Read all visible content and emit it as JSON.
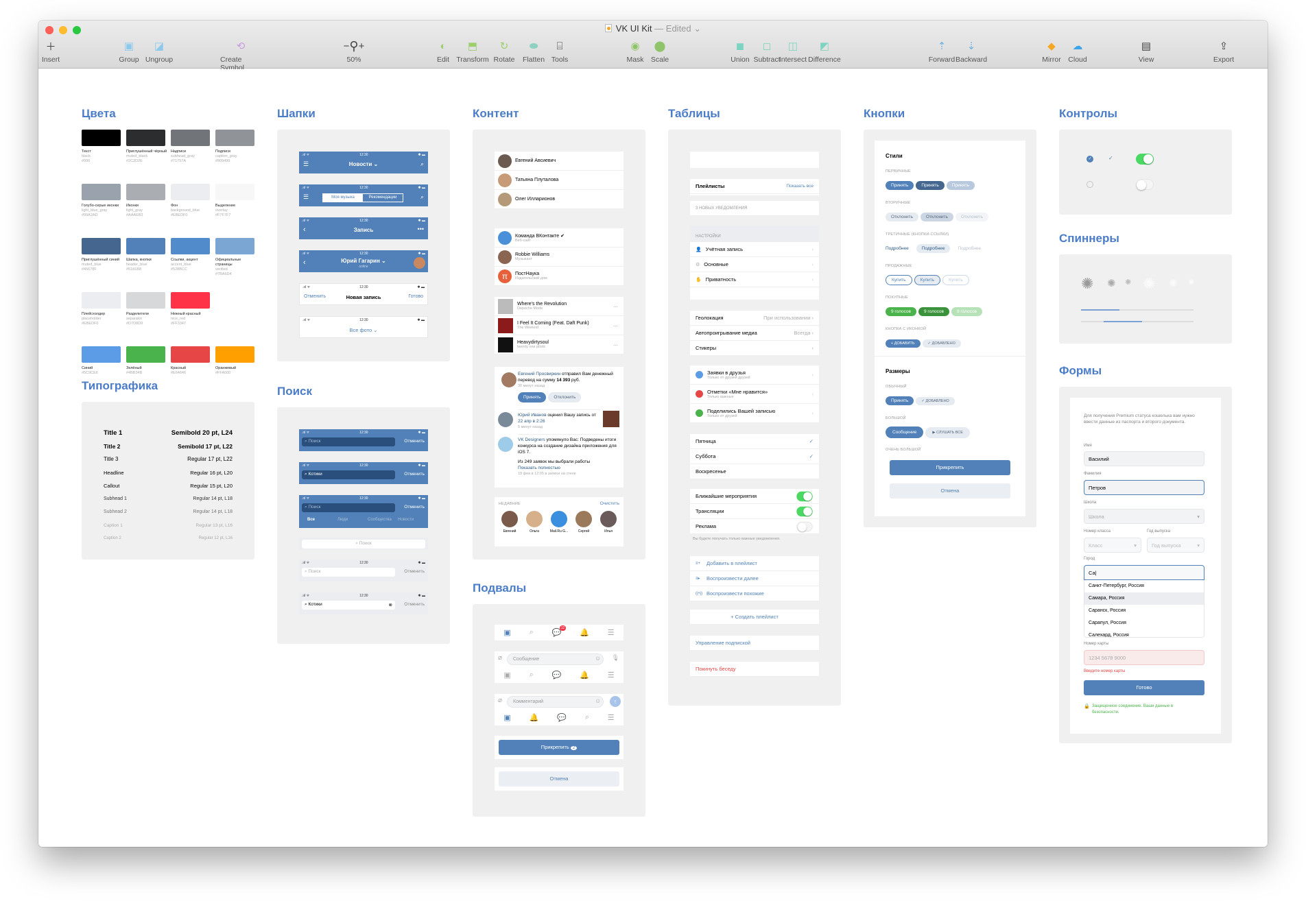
{
  "window": {
    "title": "VK UI Kit",
    "title_status": "— Edited",
    "toolbar": [
      {
        "label": "Insert",
        "icon": "plus-icon"
      },
      {
        "label": "Group",
        "icon": "group-icon"
      },
      {
        "label": "Ungroup",
        "icon": "ungroup-icon"
      },
      {
        "label": "Create Symbol",
        "icon": "symbol-icon"
      },
      {
        "label": "50%",
        "icon": "zoom-icon"
      },
      {
        "label": "Edit",
        "icon": "edit-icon"
      },
      {
        "label": "Transform",
        "icon": "transform-icon"
      },
      {
        "label": "Rotate",
        "icon": "rotate-icon"
      },
      {
        "label": "Flatten",
        "icon": "flatten-icon"
      },
      {
        "label": "Tools",
        "icon": "tools-icon"
      },
      {
        "label": "Mask",
        "icon": "mask-icon"
      },
      {
        "label": "Scale",
        "icon": "scale-icon"
      },
      {
        "label": "Union",
        "icon": "union-icon"
      },
      {
        "label": "Subtract",
        "icon": "subtract-icon"
      },
      {
        "label": "Intersect",
        "icon": "intersect-icon"
      },
      {
        "label": "Difference",
        "icon": "difference-icon"
      },
      {
        "label": "Forward",
        "icon": "forward-icon"
      },
      {
        "label": "Backward",
        "icon": "backward-icon"
      },
      {
        "label": "Mirror",
        "icon": "mirror-icon"
      },
      {
        "label": "Cloud",
        "icon": "cloud-icon"
      },
      {
        "label": "View",
        "icon": "view-icon"
      },
      {
        "label": "Export",
        "icon": "export-icon"
      }
    ],
    "zoom_minus": "−",
    "zoom_plus": "+"
  },
  "sections": {
    "colors": "Цвета",
    "typography": "Типографика",
    "headers": "Шапки",
    "search": "Поиск",
    "content": "Контент",
    "footers": "Подвалы",
    "tables": "Таблицы",
    "buttons": "Кнопки",
    "controls": "Контролы",
    "spinners": "Спиннеры",
    "forms": "Формы"
  },
  "colors": [
    {
      "name": "Текст",
      "key": "black",
      "hex": "#000"
    },
    {
      "name": "Приглушённый чёрный",
      "key": "muted_black",
      "hex": "#2C2D2E"
    },
    {
      "name": "Надписи",
      "key": "subhead_gray",
      "hex": "#71757A"
    },
    {
      "name": "Подписи",
      "key": "caption_gray",
      "hex": "#909499"
    },
    {
      "name": "Голубо-серые иконки",
      "key": "light_blue_gray",
      "hex": "#99A2AD"
    },
    {
      "name": "Иконки",
      "key": "light_gray",
      "hex": "#AAAEB3"
    },
    {
      "name": "Фон",
      "key": "background_blue",
      "hex": "#EBEDF0"
    },
    {
      "name": "Выделение",
      "key": "overlay",
      "hex": "#F7F7F7"
    },
    {
      "name": "Приглушённый синий",
      "key": "muted_blue",
      "hex": "#45678F"
    },
    {
      "name": "Шапка, кнопки",
      "key": "header_blue",
      "hex": "#5181B8"
    },
    {
      "name": "Ссылки, акцент",
      "key": "accent_blue",
      "hex": "#528BCC"
    },
    {
      "name": "Официальные страницы",
      "key": "verified",
      "hex": "#7BA6D4"
    },
    {
      "name": "Плейсхолдер",
      "key": "placeholder",
      "hex": "#EBEDF0"
    },
    {
      "name": "Разделители",
      "key": "separator",
      "hex": "#D7D8D9"
    },
    {
      "name": "Нежный красный",
      "key": "nice_red",
      "hex": "#FF3347"
    },
    {
      "name": "",
      "key": "",
      "hex": ""
    },
    {
      "name": "Синий",
      "key": "",
      "hex": "#5C9CE6"
    },
    {
      "name": "Зелёный",
      "key": "",
      "hex": "#4BB34B"
    },
    {
      "name": "Красный",
      "key": "",
      "hex": "#E64646"
    },
    {
      "name": "Оранжевый",
      "key": "",
      "hex": "#FFA000"
    }
  ],
  "typography": [
    {
      "name": "Title 1",
      "spec": "Semibold 20 pt, L24"
    },
    {
      "name": "Title 2",
      "spec": "Semibold 17 pt, L22"
    },
    {
      "name": "Title 3",
      "spec": "Regular 17 pt, L22"
    },
    {
      "name": "Headline",
      "spec": "Regular 16 pt, L20"
    },
    {
      "name": "Callout",
      "spec": "Regular 15 pt, L20"
    },
    {
      "name": "Subhead 1",
      "spec": "Regular 14 pt, L18"
    },
    {
      "name": "Subhead 2",
      "spec": "Regular 14 pt, L18"
    },
    {
      "name": "Caption 1",
      "spec": "Regular 13 pt, L16"
    },
    {
      "name": "Caption 2",
      "spec": "Regular 12 pt, L16"
    }
  ],
  "status": {
    "time": "12:30"
  },
  "headers": {
    "news": "Новости ⌄",
    "seg_a": "Моя музыка",
    "seg_b": "Рекомендации",
    "post": "Запись",
    "person": "Юрий Гагарин ⌄",
    "person_sub": "online",
    "cancel": "Отменить",
    "new_post": "Новая запись",
    "done": "Готово",
    "all_photos": "Все фото ⌄"
  },
  "search": {
    "placeholder": "Поиск",
    "query": "Котики",
    "cancel": "Отменить",
    "tabs": [
      "Все",
      "Люди",
      "Сообщества",
      "Новости"
    ]
  },
  "content": {
    "friends": [
      "Евгений Авсиевич",
      "Татьяна Плуталова",
      "Олег Илларионов"
    ],
    "groups": [
      {
        "name": "Команда ВКонтакте",
        "sub": "Веб-сайт"
      },
      {
        "name": "Robbie Williams",
        "sub": "Музыкант"
      },
      {
        "name": "ПостНаука",
        "sub": "Издательский дом"
      }
    ],
    "tracks": [
      {
        "title": "Where's the Revolution",
        "artist": "Depeche Mode"
      },
      {
        "title": "I Feel It Coming (Feat. Daft Punk)",
        "artist": "The Weeknd"
      },
      {
        "title": "Heavydirtysoul",
        "artist": "twenty one pilots"
      }
    ],
    "notif1": {
      "who": "Евгений Просвиркин",
      "text": " отправил Вам денежный перевод на сумму ",
      "amount": "14 393",
      "cur": " руб.",
      "time": "30 минут назад",
      "accept": "Принять",
      "decline": "Отклонить"
    },
    "notif2": {
      "who": "Юрий Иванов",
      "text": " оценил Вашу запись от ",
      "date": "22 апр в 2:26",
      "time": "5 минут назад"
    },
    "notif3": {
      "who": "VK Designers",
      "text": " упомянуло Вас: Подведены итоги конкурса на создание дизайна приложения для iOS 7.",
      "text2": "Из 249 заявок мы выбрали работы",
      "more": "Показать полностью",
      "time": "18 фев в 12:05 в записи на стене"
    },
    "recent_label": "НЕДАВНИЕ",
    "clear": "Очистить",
    "recent": [
      "Евгений",
      "Ольга",
      "Mail.Ru G...",
      "Сергей",
      "Илья"
    ]
  },
  "footers": {
    "message_ph": "Сообщение",
    "comment_ph": "Комментарий",
    "badge": "12",
    "attach": "Прикрепить",
    "attach_count": "2",
    "cancel": "Отмена"
  },
  "tables": {
    "playlists": "Плейлисты",
    "show_all": "Показать все",
    "new_notifs": "3 НОВЫХ УВЕДОМЛЕНИЯ",
    "settings_label": "НАСТРОЙКИ",
    "settings": [
      "Учётная запись",
      "Основные",
      "Приватность"
    ],
    "prefs": [
      {
        "label": "Геолокация",
        "value": "При использовании"
      },
      {
        "label": "Автопроигрывание медиа",
        "value": "Всегда"
      },
      {
        "label": "Стикеры",
        "value": ""
      }
    ],
    "notifs": [
      {
        "label": "Заявки в друзья",
        "sub": "Только от друзей друзей",
        "color": "#5c9ce6"
      },
      {
        "label": "Отметки «Мне нравится»",
        "sub": "Только важные",
        "color": "#e64646"
      },
      {
        "label": "Поделились Вашей записью",
        "sub": "Только от друзей",
        "color": "#4bb34b"
      }
    ],
    "days": [
      {
        "label": "Пятница",
        "checked": true
      },
      {
        "label": "Суббота",
        "checked": true
      },
      {
        "label": "Воскресенье",
        "checked": false
      }
    ],
    "toggles": [
      {
        "label": "Ближайшие мероприятия",
        "on": true
      },
      {
        "label": "Трансляции",
        "on": true
      },
      {
        "label": "Реклама",
        "on": false
      }
    ],
    "toggle_note": "Вы будете получать только важные уведомления.",
    "actions": [
      "Добавить в плейлист",
      "Воспроизвести далее",
      "Воспроизвести похожие"
    ],
    "create": "+ Создать плейлист",
    "manage": "Управление подпиской",
    "leave": "Покинуть беседу"
  },
  "buttons": {
    "styles": "Стили",
    "primary_lbl": "ПЕРВИЧНЫЕ",
    "primary": "Принять",
    "secondary_lbl": "ВТОРИЧНЫЕ",
    "secondary": "Отклонить",
    "tertiary_lbl": "ТРЕТИЧНЫЕ (КНОПКИ-ССЫЛКИ)",
    "tertiary": "Подробнее",
    "sell_lbl": "ПРОДАЖНЫЕ",
    "sell": "Купить",
    "buy_lbl": "ПОКУПНЫЕ",
    "buy": "9 голосов",
    "icon_lbl": "КНОПКА С ИКОНКОЙ",
    "add": "+ ДОБАВИТЬ",
    "added": "✓ ДОБАВЛЕНО",
    "sizes": "Размеры",
    "normal_lbl": "ОБЫЧНЫЙ",
    "normal_a": "Принять",
    "normal_b": "✓ ДОБАВЛЕНО",
    "big_lbl": "БОЛЬШОЙ",
    "big_a": "Сообщение",
    "big_b": "▶  СЛУШАТЬ ВСЕ",
    "xl_lbl": "ОЧЕНЬ БОЛЬШОЙ",
    "xl_a": "Прикрепить",
    "xl_b": "Отмена"
  },
  "controls": {
    "toggle_on": true,
    "toggle_off": false,
    "progress_1": 0.34,
    "progress_2_start": 0.2,
    "progress_2_end": 0.54
  },
  "forms": {
    "intro": "Для получения Premium статуса кошелька вам нужно ввести данные из паспорта и второго документа.",
    "name_lbl": "Имя",
    "name": "Василий",
    "surname_lbl": "Фамилия",
    "surname": "Петров",
    "school_lbl": "Школа",
    "school_ph": "Школа",
    "class_lbl": "Номер класса",
    "class_ph": "Класс",
    "year_lbl": "Год выпуска",
    "year_ph": "Год выпуска",
    "city_lbl": "Город",
    "city": "Са",
    "cities": [
      "Санкт-Петербург, Россия",
      "Самара, Россия",
      "Саранск, Россия",
      "Сарапул, Россия",
      "Салехард, Россия"
    ],
    "card_lbl": "Номер карты",
    "card_ph": "1234 5678 9000",
    "card_err": "Введите номер карты",
    "submit": "Готово",
    "secure": "Защищенное соединение. Ваши данные в безопасности."
  }
}
